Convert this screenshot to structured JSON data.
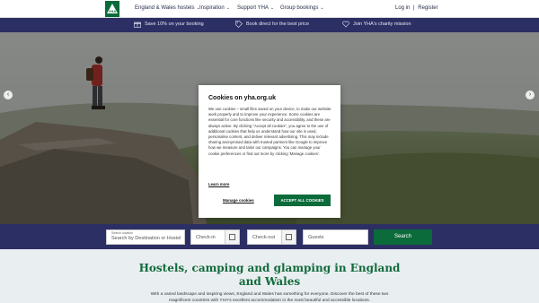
{
  "nav": {
    "logo_text": "YHA",
    "items": [
      {
        "label": "England & Wales hostels"
      },
      {
        "label": "Inspiration"
      },
      {
        "label": "Support YHA"
      },
      {
        "label": "Group bookings"
      }
    ],
    "login": "Log in",
    "separator": "|",
    "register": "Register"
  },
  "usps": [
    {
      "icon": "gift-icon",
      "label": "Save 10% on your booking"
    },
    {
      "icon": "tag-icon",
      "label": "Book direct for the best price"
    },
    {
      "icon": "heart-icon",
      "label": "Join YHA's charity mission"
    }
  ],
  "hero": {
    "prev_arrow": "‹",
    "next_arrow": "›"
  },
  "search": {
    "destination_label": "Search location",
    "destination_placeholder": "Search by Destination or Hostel",
    "checkin_placeholder": "Check-in",
    "checkout_placeholder": "Check-out",
    "guests_placeholder": "Guests",
    "button": "Search"
  },
  "main": {
    "headline": "Hostels, camping and glamping in England and Wales",
    "body": "With a varied landscape and inspiring views, England and Wales has something for everyone. Discover the best of these two magnificent countries with YHA's excellent accommodation in the most beautiful and accessible locations."
  },
  "cookie": {
    "title": "Cookies on yha.org.uk",
    "text": "We use cookies – small files saved on your device, to make our website work properly and to improve your experience. Some cookies are essential for core functions like security and accessibility, and these are always active. By clicking \"Accept all cookies\", you agree to the use of additional cookies that help us understand how our site is used, personalise content, and deliver relevant advertising. This may include sharing anonymised data with trusted partners like Google to improve how we measure and tailor our campaigns. You can manage your cookie preferences or find out more by clicking 'Manage cookies'.",
    "learn_more": "Learn more",
    "manage": "Manage cookies",
    "accept": "ACCEPT ALL COOKIES"
  },
  "colors": {
    "brand_green": "#0b6b3a",
    "navy": "#2c2f63",
    "headline_green": "#126b3c"
  }
}
